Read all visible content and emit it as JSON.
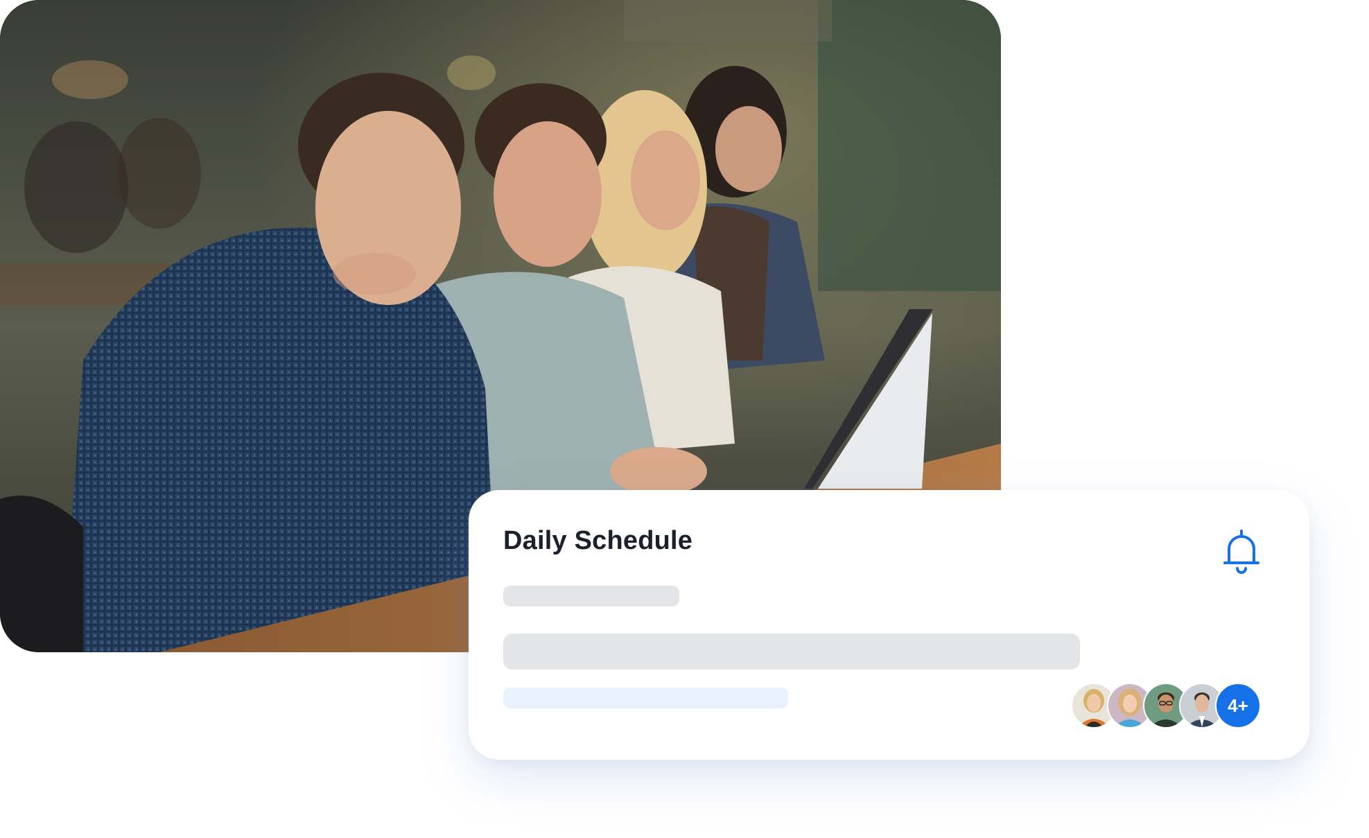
{
  "photo": {
    "subject": "students-studying-photo"
  },
  "card": {
    "title": "Daily Schedule",
    "icon": "bell-icon",
    "avatar_overflow_label": "4+"
  },
  "colors": {
    "accent": "#1670e8",
    "title": "#1c1f2c",
    "skeleton": "#e3e5e8",
    "skeleton_light": "#e8f1fc"
  }
}
